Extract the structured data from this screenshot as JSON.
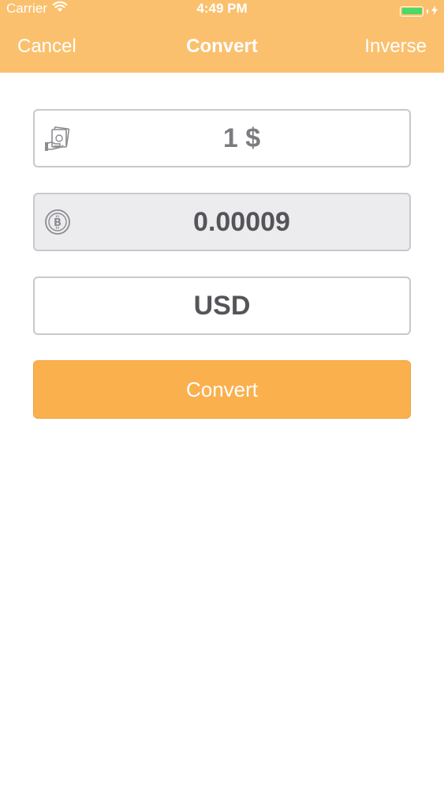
{
  "status_bar": {
    "carrier": "Carrier",
    "time": "4:49 PM",
    "wifi_icon": "wifi-icon",
    "battery_icon": "battery-icon",
    "charging_icon": "bolt-icon",
    "battery_color": "#4cd964"
  },
  "nav": {
    "cancel_label": "Cancel",
    "title": "Convert",
    "inverse_label": "Inverse"
  },
  "form": {
    "amount_icon": "cash-hand-icon",
    "amount_value": "1 $",
    "result_icon": "bitcoin-icon",
    "result_value": "0.00009",
    "currency_value": "USD",
    "convert_label": "Convert"
  },
  "colors": {
    "header": "#fbc06d",
    "button": "#fbb04e",
    "result_field_bg": "#ececef",
    "field_border": "#c9c9cc"
  }
}
